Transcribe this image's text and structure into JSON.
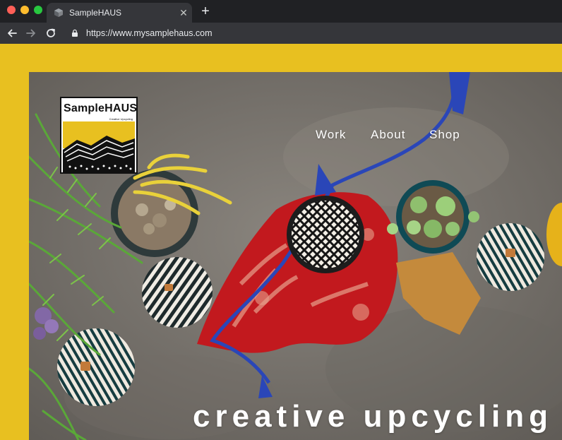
{
  "browser": {
    "tab_title": "SampleHAUS",
    "url": "https://www.mysamplehaus.com",
    "close_glyph": "✕",
    "new_tab_glyph": "+"
  },
  "site": {
    "logo_name": "SampleHAUS",
    "logo_tagline": "Creative Upcycling",
    "nav": [
      "Work",
      "About",
      "Shop"
    ],
    "headline": "creative upcycling"
  },
  "colors": {
    "accent_yellow": "#e8c020",
    "browser_dark": "#202124",
    "toolbar": "#35363a"
  }
}
